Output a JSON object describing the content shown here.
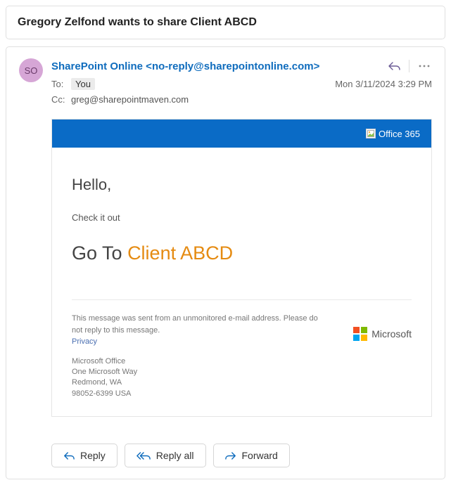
{
  "subject": "Gregory Zelfond wants to share Client ABCD",
  "avatar_initials": "SO",
  "sender": "SharePoint Online <no-reply@sharepointonline.com>",
  "to_label": "To:",
  "to_value": "You",
  "cc_label": "Cc:",
  "cc_value": "greg@sharepointmaven.com",
  "timestamp": "Mon 3/11/2024 3:29 PM",
  "banner_text": "Office 365",
  "body": {
    "greeting": "Hello,",
    "line1": "Check it out",
    "go_prefix": "Go To ",
    "go_link": "Client ABCD"
  },
  "footer": {
    "unmonitored": "This message was sent from an unmonitored e-mail address. Please do not reply to this message.",
    "privacy": "Privacy",
    "addr1": "Microsoft Office",
    "addr2": "One Microsoft Way",
    "addr3": "Redmond, WA",
    "addr4": "98052-6399 USA",
    "ms_word": "Microsoft"
  },
  "actions": {
    "reply": "Reply",
    "reply_all": "Reply all",
    "forward": "Forward"
  }
}
